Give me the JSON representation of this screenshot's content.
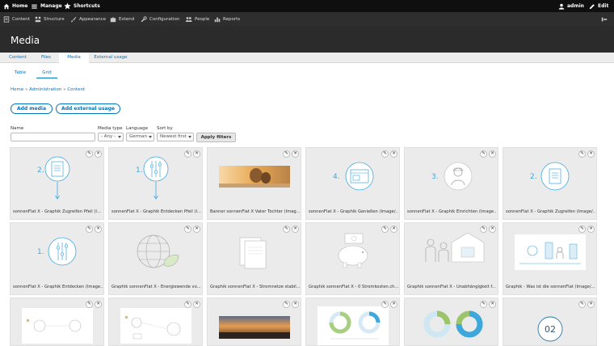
{
  "toolbar": {
    "home": "Home",
    "manage": "Manage",
    "shortcuts": "Shortcuts",
    "user": "admin",
    "edit": "Edit"
  },
  "tray": {
    "items": [
      "Content",
      "Structure",
      "Appearance",
      "Extend",
      "Configuration",
      "People",
      "Reports"
    ]
  },
  "page": {
    "title": "Media"
  },
  "tabs": [
    "Content",
    "Files",
    "Media",
    "External usage"
  ],
  "subtabs": [
    "Table",
    "Grid"
  ],
  "breadcrumb": [
    "Home",
    "Administration",
    "Content"
  ],
  "buttons": {
    "add_media": "Add media",
    "add_external": "Add external usage"
  },
  "filters": {
    "name_label": "Name",
    "name_value": "",
    "type_label": "Media type",
    "type_value": "- Any -",
    "lang_label": "Language",
    "lang_value": "German",
    "sort_label": "Sort by",
    "sort_value": "Newest first",
    "apply": "Apply filters"
  },
  "colors": {
    "accent": "#0074bd",
    "toolbar": "#0f0f0f",
    "tray": "#2e2e2e",
    "header": "#2b2b2b",
    "illustration": "#3ea8dc"
  },
  "media": [
    {
      "caption": "sonnenFlat X - Graphik Zugreifen Pfeil (I...",
      "thumb": "step-doc-arrow",
      "num": "2."
    },
    {
      "caption": "sonnenFlat X - Graphik Entdecken Pfeil (I...",
      "thumb": "step-sliders-arrow",
      "num": "1."
    },
    {
      "caption": "Banner sonnenFlat X Vater Tochter (Imag...",
      "thumb": "photo-banner"
    },
    {
      "caption": "sonnenFlat X - Graphik Genießen (Image/...",
      "thumb": "step-browser",
      "num": "4."
    },
    {
      "caption": "sonnenFlat X - Graphik Einrichten (Image...",
      "thumb": "step-worker",
      "num": "3."
    },
    {
      "caption": "sonnenFlat X - Graphik Zugreifen (Image/...",
      "thumb": "step-doc",
      "num": "2."
    },
    {
      "caption": "sonnenFlat X - Graphik Entdecken (Image...",
      "thumb": "step-sliders",
      "num": "1."
    },
    {
      "caption": "Graphik sonnenFlat X - Energiewende vo...",
      "thumb": "globe-leaf"
    },
    {
      "caption": "Graphik sonnenFlat X - Stromnetze stabil...",
      "thumb": "documents"
    },
    {
      "caption": "Graphik sonnenFlat X - 0 Stromkosten.ch...",
      "thumb": "piggy-bank"
    },
    {
      "caption": "Graphik sonnenFlat X - Unabhängigkeit f...",
      "thumb": "family-house"
    },
    {
      "caption": "Graphik - Was ist die sonnenFlat (Image/...",
      "thumb": "infographic"
    },
    {
      "caption": "",
      "thumb": "diagram-a"
    },
    {
      "caption": "",
      "thumb": "diagram-b"
    },
    {
      "caption": "",
      "thumb": "photo-sunset"
    },
    {
      "caption": "",
      "thumb": "donut-pair-blue"
    },
    {
      "caption": "",
      "thumb": "donut-pair-green"
    },
    {
      "caption": "",
      "thumb": "number-circle",
      "num": "02"
    }
  ],
  "ops": {
    "edit": "✎",
    "remove": "✕"
  }
}
